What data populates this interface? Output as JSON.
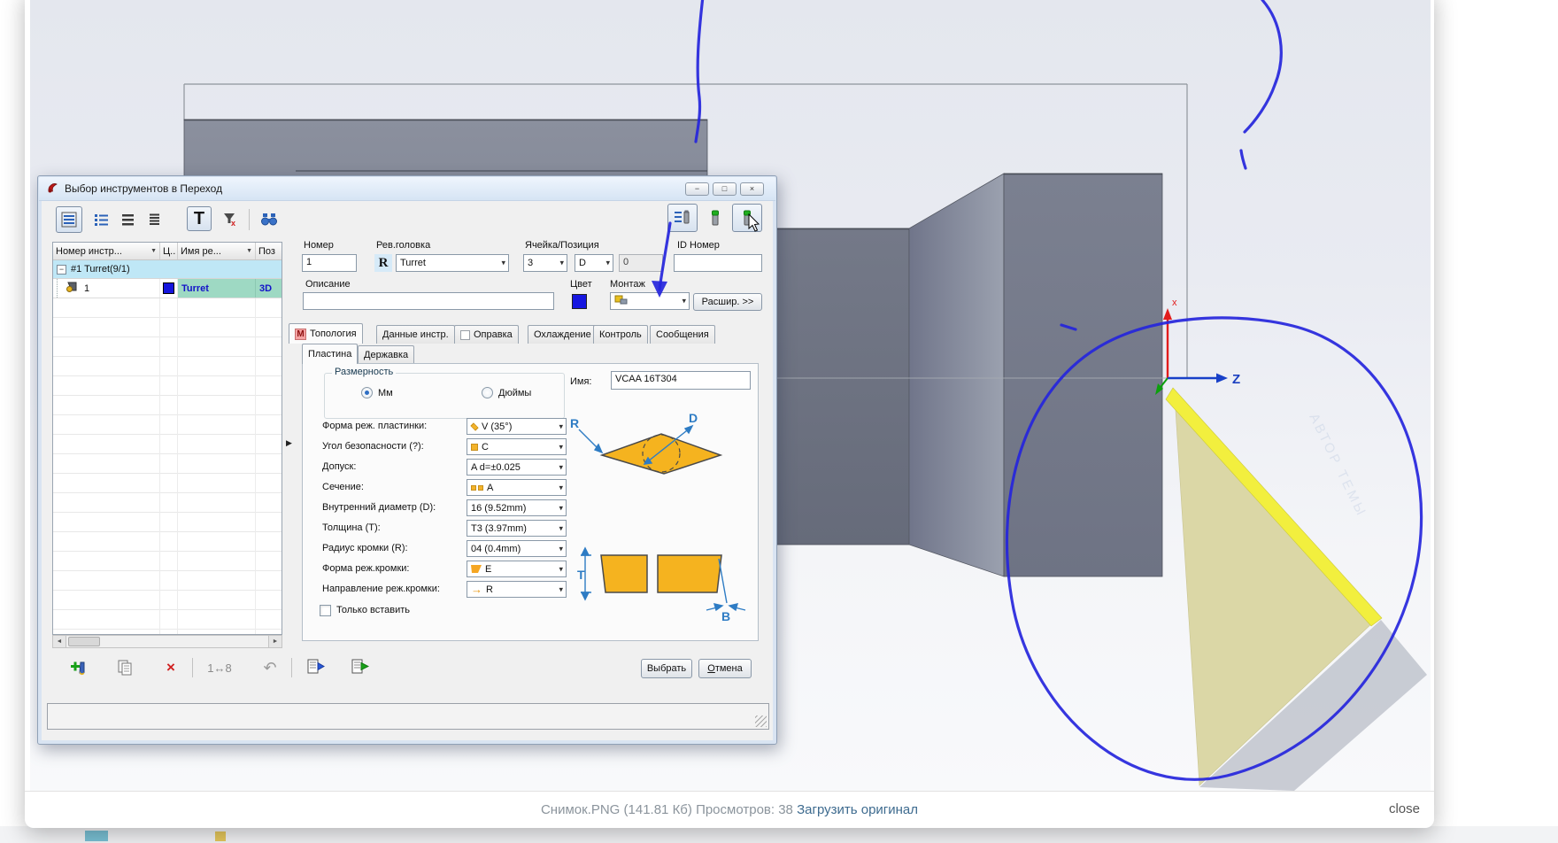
{
  "lightbox": {
    "caption": {
      "filename": "Снимок.PNG (141.81 Кб)",
      "views": "Просмотров: 38",
      "download_link": "Загрузить оригинал"
    },
    "close_label": "close"
  },
  "viewport": {
    "axis_z_label": "Z",
    "axis_x_label": "x",
    "watermark": "АВТОР ТЕМЫ",
    "colors": {
      "annotation_blue": "#2525dc",
      "insert_edge_yellow": "#f2ef3e",
      "insert_face_khaki": "#dbd7a6",
      "part_gray": "#767b8a",
      "axis_red": "#e21d1d",
      "axis_blue": "#1840c8",
      "axis_green": "#0ca00c"
    }
  },
  "dialog": {
    "title": "Выбор инструментов в Переход",
    "window_buttons": {
      "minimize": "−",
      "maximize": "□",
      "close": "×"
    },
    "toolbar": {
      "text_button": "T"
    },
    "table": {
      "columns": [
        "Номер инстр...",
        "Ц..",
        "Имя ре...",
        "Поз"
      ],
      "group_row": "#1 Turret(9/1)",
      "expand_glyph": "−",
      "row": {
        "num": "1",
        "name": "Turret",
        "pos": "3D",
        "color": "#1515dd"
      }
    },
    "fields": {
      "number": {
        "label": "Номер",
        "value": "1"
      },
      "rev_head": {
        "label": "Рев.головка",
        "badge": "R",
        "value": "Turret"
      },
      "cell_pos": {
        "label": "Ячейка/Позиция",
        "cell": "3",
        "position": "D",
        "aux": "0"
      },
      "id_number": {
        "label": "ID Номер",
        "value": ""
      },
      "description": {
        "label": "Описание",
        "value": ""
      },
      "color": {
        "label": "Цвет",
        "value": "#1717e0"
      },
      "mount": {
        "label": "Монтаж"
      },
      "expand_button": "Расшир. >>"
    },
    "tabs": [
      {
        "label": "Топология",
        "icon": "M"
      },
      {
        "label": "Данные инстр."
      },
      {
        "label": "Оправка"
      },
      {
        "label": "Охлаждение"
      },
      {
        "label": "Контроль"
      },
      {
        "label": "Сообщения"
      }
    ],
    "subtabs": [
      {
        "label": "Пластина"
      },
      {
        "label": "Державка"
      }
    ],
    "plate": {
      "dimension_group": {
        "label": "Размерность",
        "mm": "Мм",
        "inch": "Дюймы",
        "selected": "Мм"
      },
      "name_field": {
        "label": "Имя:",
        "value": "VCAA 16T304"
      },
      "rows": [
        {
          "label": "Форма реж. пластинки:",
          "value": "V (35°)",
          "icon": "insert-shape-icon"
        },
        {
          "label": "Угол безопасности (?):",
          "value": "C",
          "icon": "clearance-angle-icon"
        },
        {
          "label": "Допуск:",
          "value": "A d=±0.025"
        },
        {
          "label": "Сечение:",
          "value": "A",
          "icon": "cross-section-icon"
        },
        {
          "label": "Внутренний диаметр (D):",
          "value": "16 (9.52mm)"
        },
        {
          "label": "Толщина (T):",
          "value": "T3 (3.97mm)"
        },
        {
          "label": "Радиус кромки (R):",
          "value": "04 (0.4mm)"
        },
        {
          "label": "Форма реж.кромки:",
          "value": "E",
          "icon": "edge-shape-icon"
        },
        {
          "label": "Направление реж.кромки:",
          "value": "R",
          "icon": "edge-direction-icon"
        }
      ],
      "insert_only_label": "Только вставить",
      "diagram_labels": {
        "r": "R",
        "d": "D",
        "t": "T",
        "b": "B"
      }
    },
    "bottom_toolbar": {
      "renumber_label": "1↔8",
      "undo_glyph": "↶",
      "delete_glyph": "×"
    },
    "actions": {
      "select": "Выбрать",
      "cancel_initial": "О",
      "cancel_rest": "тмена"
    },
    "splitter_glyph": "▶",
    "combo_arrow": "▾"
  }
}
